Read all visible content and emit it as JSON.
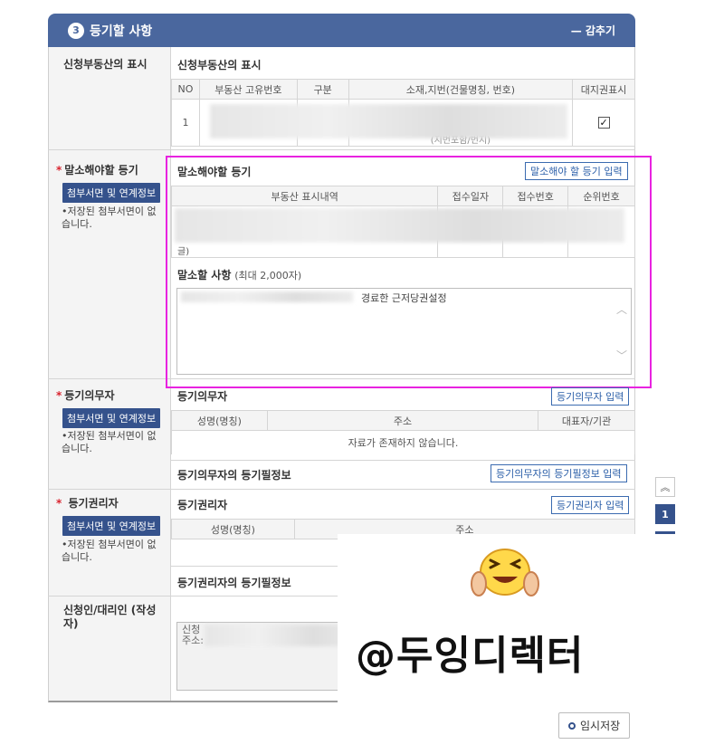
{
  "header": {
    "step": "3",
    "title": "등기할 사항",
    "collapse": "— 감추기"
  },
  "property": {
    "left_label": "신청부동산의 표시",
    "title": "신청부동산의 표시",
    "columns": [
      "NO",
      "부동산 고유번호",
      "구분",
      "소재,지번(건물명칭, 번호)",
      "대지권표시"
    ],
    "row": {
      "no": "1",
      "address_tail": "(지번포함/번지)"
    }
  },
  "cancel": {
    "left_label": "말소해야할 등기",
    "attach_btn": "첨부서면 및 연계정보",
    "note": "•저장된 첨부서면이 없습니다.",
    "title": "말소해야할 등기",
    "input_btn": "말소해야 할 등기 입력",
    "columns": [
      "부동산 표시내역",
      "접수일자",
      "접수번호",
      "순위번호"
    ],
    "row_tail": "글)",
    "matters_title": "말소할 사항",
    "matters_limit": "(최대 2,000자)",
    "matters_text": "경료한 근저당권설정"
  },
  "obligor": {
    "left_label": "등기의무자",
    "attach_btn": "첨부서면 및 연계정보",
    "note": "•저장된 첨부서면이 없습니다.",
    "title": "등기의무자",
    "input_btn": "등기의무자 입력",
    "columns": [
      "성명(명칭)",
      "주소",
      "대표자/기관"
    ],
    "empty": "자료가 존재하지 않습니다.",
    "info_title": "등기의무자의 등기필정보",
    "info_btn": "등기의무자의 등기필정보 입력"
  },
  "rightholder": {
    "left_label": "등기권리자",
    "attach_btn": "첨부서면 및 연계정보",
    "note": "•저장된 첨부서면이 없습니다.",
    "title": "등기권리자",
    "input_btn": "등기권리자 입력",
    "columns": [
      "성명(명칭)",
      "주소"
    ],
    "info_title": "등기권리자의 등기필정보"
  },
  "applicant": {
    "left_label": "신청인/대리인 (작성자)",
    "line1": "신청",
    "line2": "주소:"
  },
  "pager": {
    "up": "︽",
    "page": "1"
  },
  "save_btn": "임시저장",
  "watermark": "@두잉디렉터",
  "colors": {
    "header": "#4a679e",
    "navy_button": "#35528c",
    "required": "#d9232e",
    "highlight": "#e823e0"
  }
}
